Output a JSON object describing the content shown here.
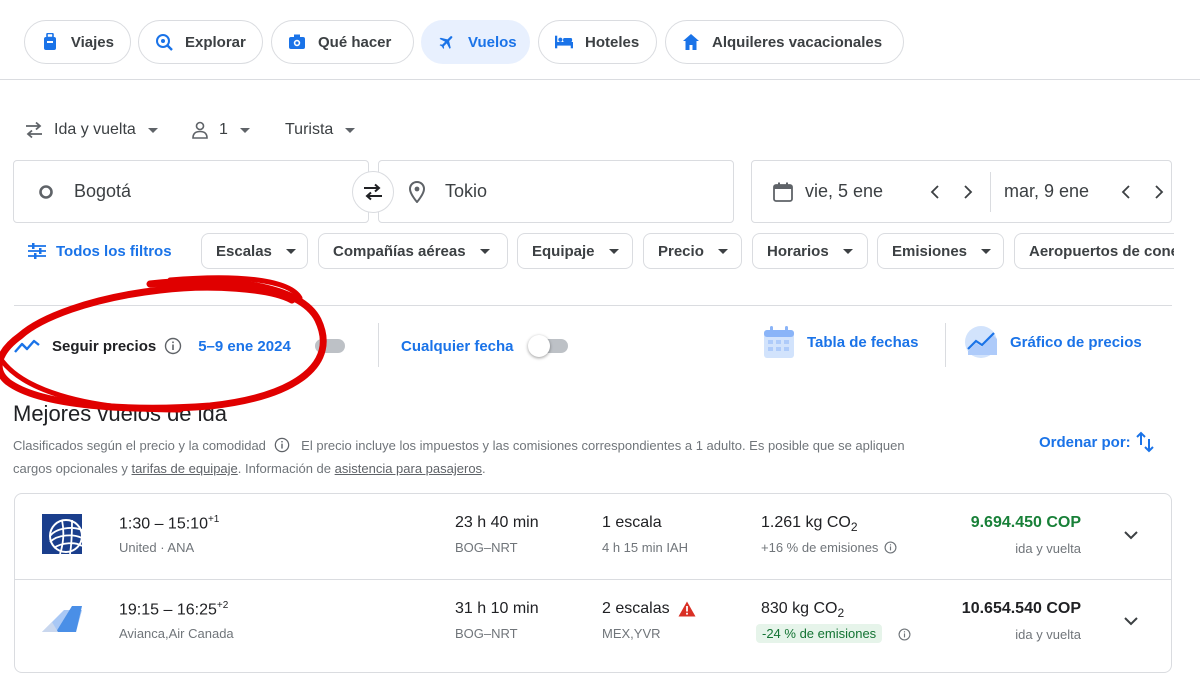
{
  "nav": {
    "items": [
      {
        "label": "Viajes",
        "icon": "suitcase-icon"
      },
      {
        "label": "Explorar",
        "icon": "explore-icon"
      },
      {
        "label": "Qué hacer",
        "icon": "camera-icon"
      },
      {
        "label": "Vuelos",
        "icon": "airplane-icon",
        "active": true
      },
      {
        "label": "Hoteles",
        "icon": "bed-icon"
      },
      {
        "label": "Alquileres vacacionales",
        "icon": "house-icon"
      }
    ]
  },
  "options": {
    "trip_type": "Ida y vuelta",
    "passengers": "1",
    "cabin": "Turista"
  },
  "search": {
    "origin": "Bogotá",
    "destination": "Tokio",
    "depart_date": "vie, 5 ene",
    "return_date": "mar, 9 ene"
  },
  "filters": {
    "all_label": "Todos los filtros",
    "chips": [
      "Escalas",
      "Compañías aéreas",
      "Equipaje",
      "Precio",
      "Horarios",
      "Emisiones",
      "Aeropuertos de conexión"
    ]
  },
  "tracking": {
    "track_label": "Seguir precios",
    "track_dates": "5–9 ene 2024",
    "any_date_label": "Cualquier fecha",
    "date_grid_label": "Tabla de fechas",
    "price_graph_label": "Gráfico de precios"
  },
  "section": {
    "title": "Mejores vuelos de ida",
    "desc_1": "Clasificados según el precio y la comodidad",
    "desc_2": "El precio incluye los impuestos y las comisiones correspondientes a 1 adulto. Es posible que se apliquen",
    "desc_3": "cargos opcionales y",
    "desc_link_1": "tarifas de equipaje",
    "desc_4": ". Información de",
    "desc_link_2": "asistencia para pasajeros",
    "desc_5": ".",
    "sort_label": "Ordenar por:"
  },
  "flights": [
    {
      "times": "1:30 – 15:10",
      "day_offset": "+1",
      "airlines": "United · ANA",
      "duration": "23 h 40 min",
      "route": "BOG–NRT",
      "stops": "1 escala",
      "stop_detail": "4 h 15 min IAH",
      "co2": "1.261 kg CO",
      "co2_sub": "2",
      "emissions": "+16 % de emisiones",
      "price": "9.694.450 COP",
      "price_color": "#188038",
      "price_note": "ida y vuelta"
    },
    {
      "times": "19:15 – 16:25",
      "day_offset": "+2",
      "airlines": "Avianca,Air Canada",
      "duration": "31 h 10 min",
      "route": "BOG–NRT",
      "stops": "2 escalas",
      "stop_detail": "MEX,YVR",
      "co2": "830 kg CO",
      "co2_sub": "2",
      "emissions": "-24 % de emisiones",
      "price": "10.654.540 COP",
      "price_color": "#202124",
      "price_note": "ida y vuelta"
    }
  ],
  "colors": {
    "accent": "#1a73e8",
    "annotation": "#e00000"
  }
}
